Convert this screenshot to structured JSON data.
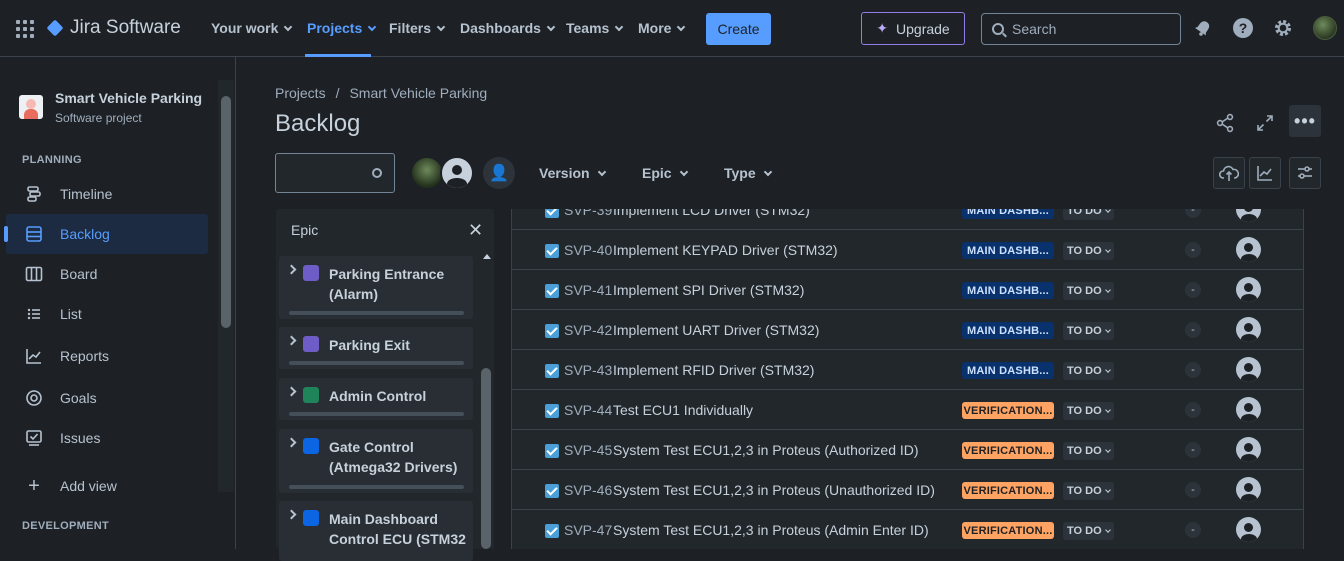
{
  "topnav": {
    "product": "Jira Software",
    "items": [
      {
        "label": "Your work"
      },
      {
        "label": "Projects"
      },
      {
        "label": "Filters"
      },
      {
        "label": "Dashboards"
      },
      {
        "label": "Teams"
      },
      {
        "label": "More"
      }
    ],
    "create_label": "Create",
    "upgrade_label": "Upgrade",
    "search_placeholder": "Search"
  },
  "sidebar": {
    "project_name": "Smart Vehicle Parking",
    "project_type": "Software project",
    "planning_heading": "PLANNING",
    "items": [
      {
        "label": "Timeline",
        "icon": "timeline-icon"
      },
      {
        "label": "Backlog",
        "icon": "backlog-icon"
      },
      {
        "label": "Board",
        "icon": "board-icon"
      },
      {
        "label": "List",
        "icon": "list-icon"
      },
      {
        "label": "Reports",
        "icon": "reports-icon"
      },
      {
        "label": "Goals",
        "icon": "goals-icon"
      },
      {
        "label": "Issues",
        "icon": "issues-icon"
      }
    ],
    "add_view_label": "Add view",
    "development_heading": "DEVELOPMENT"
  },
  "breadcrumb": {
    "root": "Projects",
    "separator": "/",
    "current": "Smart Vehicle Parking"
  },
  "page_title": "Backlog",
  "filters": {
    "version_label": "Version",
    "epic_label": "Epic",
    "type_label": "Type"
  },
  "epic_panel": {
    "title": "Epic",
    "epics": [
      {
        "title": "Parking Entrance (Alarm)",
        "color": "#6e5dc6"
      },
      {
        "title": "Parking Exit",
        "color": "#6e5dc6"
      },
      {
        "title": "Admin Control",
        "color": "#1f845a"
      },
      {
        "title": "Gate Control (Atmega32 Drivers)",
        "color": "#0c66e4"
      },
      {
        "title": "Main Dashboard Control ECU (STM32",
        "color": "#0c66e4"
      }
    ]
  },
  "issues": [
    {
      "key": "SVP-39",
      "summary": "Implement LCD Driver (STM32)",
      "epic": "MAIN DASHB...",
      "epic_style": "blue",
      "status": "TO DO",
      "points": "-"
    },
    {
      "key": "SVP-40",
      "summary": "Implement KEYPAD Driver (STM32)",
      "epic": "MAIN DASHB...",
      "epic_style": "blue",
      "status": "TO DO",
      "points": "-"
    },
    {
      "key": "SVP-41",
      "summary": "Implement SPI Driver (STM32)",
      "epic": "MAIN DASHB...",
      "epic_style": "blue",
      "status": "TO DO",
      "points": "-"
    },
    {
      "key": "SVP-42",
      "summary": "Implement UART Driver (STM32)",
      "epic": "MAIN DASHB...",
      "epic_style": "blue",
      "status": "TO DO",
      "points": "-"
    },
    {
      "key": "SVP-43",
      "summary": "Implement RFID Driver (STM32)",
      "epic": "MAIN DASHB...",
      "epic_style": "blue",
      "status": "TO DO",
      "points": "-"
    },
    {
      "key": "SVP-44",
      "summary": "Test ECU1 Individually",
      "epic": "VERIFICATION...",
      "epic_style": "orange",
      "status": "TO DO",
      "points": "-"
    },
    {
      "key": "SVP-45",
      "summary": "System Test ECU1,2,3 in Proteus (Authorized ID)",
      "epic": "VERIFICATION...",
      "epic_style": "orange",
      "status": "TO DO",
      "points": "-"
    },
    {
      "key": "SVP-46",
      "summary": "System Test ECU1,2,3 in Proteus (Unauthorized ID)",
      "epic": "VERIFICATION...",
      "epic_style": "orange",
      "status": "TO DO",
      "points": "-"
    },
    {
      "key": "SVP-47",
      "summary": "System Test ECU1,2,3 in Proteus (Admin Enter ID)",
      "epic": "VERIFICATION...",
      "epic_style": "orange",
      "status": "TO DO",
      "points": "-"
    }
  ],
  "colors": {
    "accent": "#579dff",
    "background": "#1d2125",
    "surface": "#22272b"
  }
}
